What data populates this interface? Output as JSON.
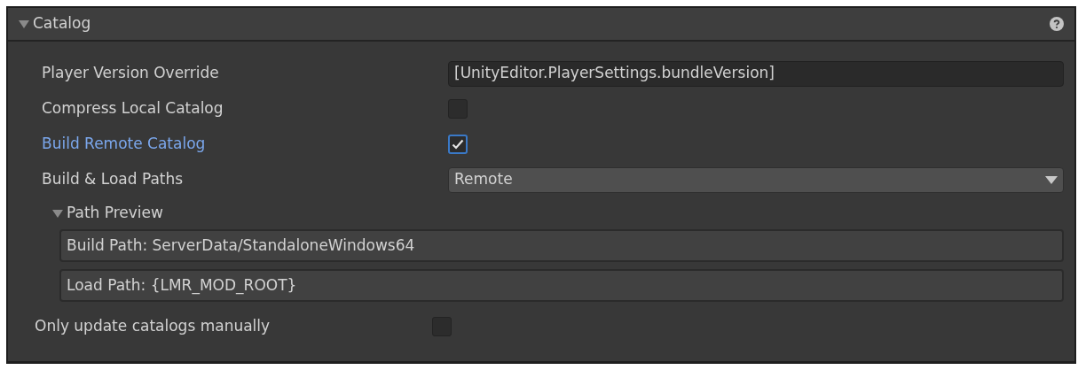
{
  "section": {
    "title": "Catalog",
    "expanded": true
  },
  "rows": [
    {
      "kind": "text",
      "label": "Player Version Override",
      "highlighted": false,
      "value": "[UnityEditor.PlayerSettings.bundleVersion]"
    },
    {
      "kind": "checkbox",
      "label": "Compress Local Catalog",
      "highlighted": false,
      "checked": false
    },
    {
      "kind": "checkbox",
      "label": "Build Remote Catalog",
      "highlighted": true,
      "checked": true
    },
    {
      "kind": "dropdown",
      "label": "Build & Load Paths",
      "highlighted": false,
      "value": "Remote"
    }
  ],
  "path_preview": {
    "title": "Path Preview",
    "expanded": true,
    "paths": [
      "Build Path: ServerData/StandaloneWindows64",
      "Load Path: {LMR_MOD_ROOT}"
    ]
  },
  "footer_rows": [
    {
      "kind": "checkbox",
      "label": "Only update catalogs manually",
      "highlighted": false,
      "checked": false
    }
  ]
}
